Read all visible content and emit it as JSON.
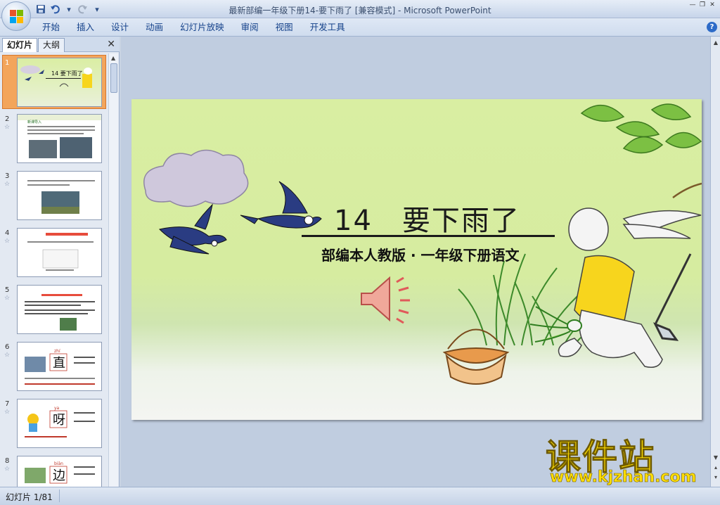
{
  "window": {
    "title": "最新部编一年级下册14-要下雨了 [兼容模式] - Microsoft PowerPoint"
  },
  "quick_access": [
    "save-icon",
    "undo-icon",
    "redo-icon",
    "customize-icon"
  ],
  "ribbon": {
    "tabs": [
      "开始",
      "插入",
      "设计",
      "动画",
      "幻灯片放映",
      "审阅",
      "视图",
      "开发工具"
    ]
  },
  "left_pane": {
    "tab_slides": "幻灯片",
    "tab_outline": "大纲",
    "close": "✕",
    "thumbnails": [
      {
        "num": "1",
        "selected": true,
        "caption": "14 要下雨了"
      },
      {
        "num": "2",
        "caption": "新课导入"
      },
      {
        "num": "3",
        "caption": ""
      },
      {
        "num": "4",
        "caption": ""
      },
      {
        "num": "5",
        "caption": ""
      },
      {
        "num": "6",
        "caption": "直",
        "pinyin": "zhí"
      },
      {
        "num": "7",
        "caption": "呀",
        "pinyin": "ya"
      },
      {
        "num": "8",
        "caption": "边",
        "pinyin": "biān"
      }
    ]
  },
  "slide": {
    "title": "14　要下雨了",
    "subtitle": "部编本人教版 · 一年级下册语文"
  },
  "status": {
    "slide_counter": "幻灯片 1/81"
  },
  "watermark": {
    "brand": "课件站",
    "url": "www.kjzhan.com"
  },
  "colors": {
    "ribbon_text": "#15428b",
    "selection": "#f3a55b",
    "slide_bg": "#d9eea2",
    "watermark": "#ffde00"
  }
}
